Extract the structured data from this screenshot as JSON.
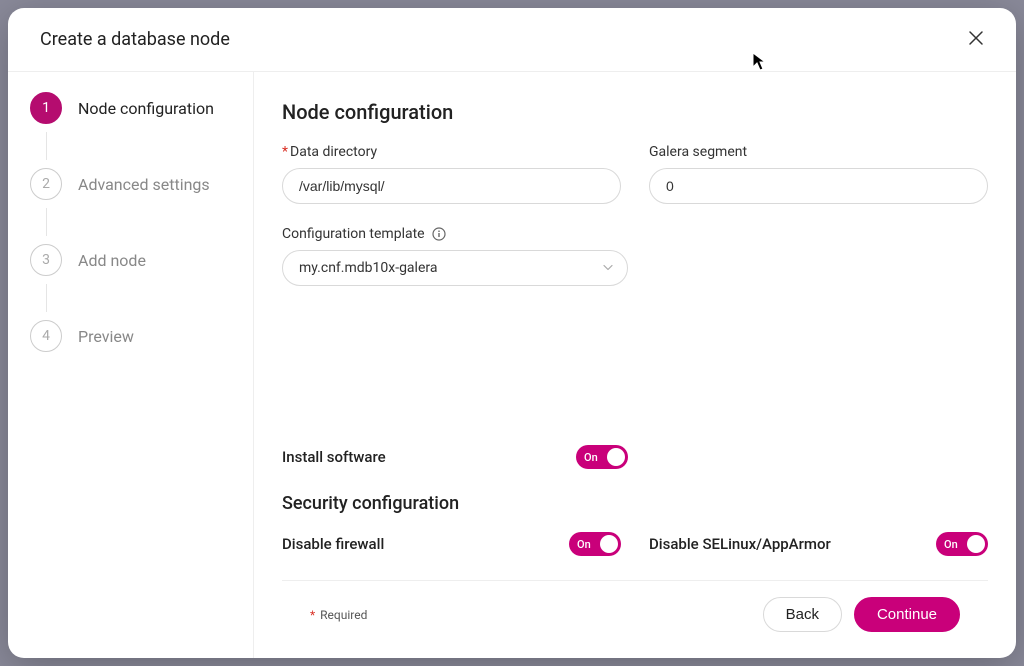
{
  "modal": {
    "title": "Create a database node"
  },
  "steps": [
    {
      "num": "1",
      "label": "Node configuration",
      "active": true
    },
    {
      "num": "2",
      "label": "Advanced settings",
      "active": false
    },
    {
      "num": "3",
      "label": "Add node",
      "active": false
    },
    {
      "num": "4",
      "label": "Preview",
      "active": false
    }
  ],
  "form": {
    "section_title": "Node configuration",
    "data_directory": {
      "label": "Data directory",
      "value": "/var/lib/mysql/",
      "required": true
    },
    "galera_segment": {
      "label": "Galera segment",
      "value": "0"
    },
    "config_template": {
      "label": "Configuration template",
      "value": "my.cnf.mdb10x-galera"
    },
    "install_software": {
      "label": "Install software",
      "value": "On"
    },
    "security_title": "Security configuration",
    "disable_firewall": {
      "label": "Disable firewall",
      "value": "On"
    },
    "disable_selinux": {
      "label": "Disable SELinux/AppArmor",
      "value": "On"
    }
  },
  "footer": {
    "required_label": "Required",
    "back": "Back",
    "continue": "Continue"
  }
}
